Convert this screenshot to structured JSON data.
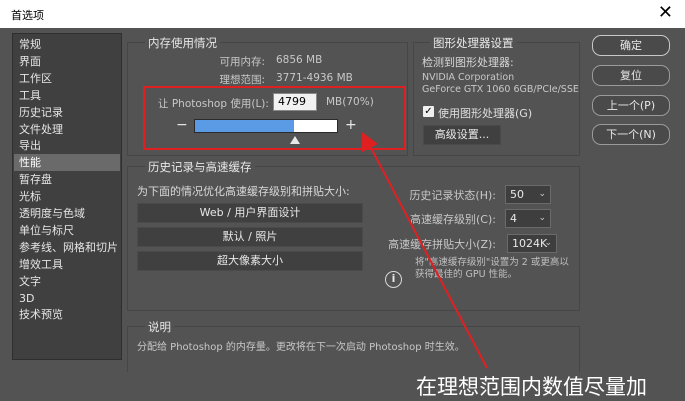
{
  "window": {
    "title": "首选项",
    "close_symbol": "✕"
  },
  "nav": {
    "items": [
      "常规",
      "界面",
      "工作区",
      "工具",
      "历史记录",
      "文件处理",
      "导出",
      "性能",
      "暂存盘",
      "光标",
      "透明度与色域",
      "单位与标尺",
      "参考线、网格和切片",
      "增效工具",
      "文字",
      "3D",
      "技术预览"
    ],
    "selected_index": 7
  },
  "memory": {
    "title": "内存使用情况",
    "available_label": "可用内存:",
    "available_value": "6856 MB",
    "ideal_label": "理想范围:",
    "ideal_value": "3771-4936 MB",
    "let_label": "让 Photoshop 使用(L):",
    "let_value": "4799",
    "let_unit": "MB(70%)",
    "minus": "−",
    "plus": "+",
    "slider_fraction": 0.7
  },
  "gpu": {
    "title": "图形处理器设置",
    "detected_label": "检测到图形处理器:",
    "vendor": "NVIDIA Corporation",
    "model": "GeForce GTX 1060 6GB/PCIe/SSE",
    "use_gpu_label": "使用图形处理器(G)",
    "use_gpu_checked": true,
    "advanced_button": "高级设置..."
  },
  "history": {
    "title": "历史记录与高速缓存",
    "optimize_label": "为下面的情况优化高速缓存级别和拼贴大小:",
    "buttons": [
      "Web / 用户界面设计",
      "默认 / 照片",
      "超大像素大小"
    ],
    "history_states_label": "历史记录状态(H):",
    "history_states_value": "50",
    "cache_levels_label": "高速缓存级别(C):",
    "cache_levels_value": "4",
    "tile_size_label": "高速缓存拼贴大小(Z):",
    "tile_size_value": "1024K",
    "note": "将\"高速缓存级别\"设置为 2 或更高以获得最佳的 GPU 性能。",
    "info_icon_char": "i"
  },
  "description": {
    "title": "说明",
    "text": "分配给 Photoshop 的内存量。更改将在下一次启动 Photoshop 时生效。"
  },
  "actions": {
    "ok": "确定",
    "reset": "复位",
    "prev": "上一个(P)",
    "next": "下一个(N)"
  },
  "annotation": {
    "text": "在理想范围内数值尽量加",
    "color": "#e02020"
  }
}
